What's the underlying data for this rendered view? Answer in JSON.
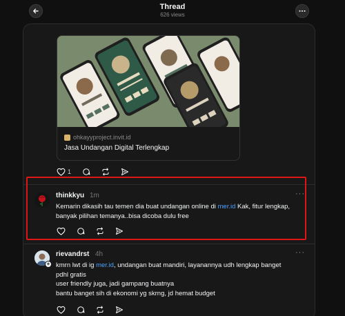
{
  "header": {
    "title": "Thread",
    "views": "626 views"
  },
  "first_post": {
    "link_card": {
      "domain": "ohkayyproject.invit.id",
      "title": "Jasa Undangan Digital Terlengkap"
    },
    "likes": "1"
  },
  "reply_thinkkyu": {
    "username": "thinkkyu",
    "time": "1m",
    "text_before": "Kemarin dikasih tau temen dia buat undangan online di ",
    "link": "mer.id",
    "text_after": " Kak, fitur lengkap, banyak pilihan temanya..bisa dicoba dulu free",
    "more": "···"
  },
  "reply_rievandrst": {
    "username": "rievandrst",
    "time": "4h",
    "line1_before": "kmrn lwt di ig ",
    "line1_link": "mer.id",
    "line1_after": ", undangan buat mandiri, layanannya udh lengkap banget",
    "line2": "pdhl gratis",
    "line3": "user friendly juga, jadi gampang buatnya",
    "line4": "bantu banget sih di ekonomi yg skrng, jd hemat budget",
    "more": "···"
  },
  "colors": {
    "highlight": "#e01616",
    "link": "#4aa3ff"
  }
}
